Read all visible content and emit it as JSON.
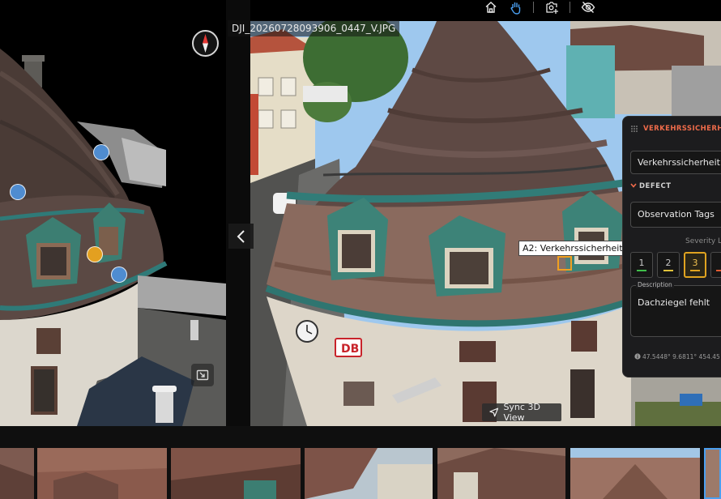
{
  "toolbar": {
    "icons": [
      "home-icon",
      "hand-pan-icon",
      "add-photo-icon",
      "hide-icon"
    ],
    "active_icon": "hand-pan-icon",
    "accent": "#4a9ff0"
  },
  "model_view": {
    "compass_icon": "compass-icon",
    "markers": [
      {
        "color": "blue"
      },
      {
        "color": "blue"
      },
      {
        "color": "orange"
      },
      {
        "color": "blue"
      }
    ],
    "expand_icon": "picture-in-picture-icon",
    "collapse_icon": "chevron-left-icon"
  },
  "photo": {
    "filename": "DJI_20260728093906_0447_V.JPG",
    "annotation_label": "A2: Verkehrssicherheit",
    "sync_label": "Sync 3D View",
    "sync_icon": "navigation-arrow-icon"
  },
  "panel": {
    "title": "VERKEHRSSICHERH...",
    "category_value": "Verkehrssicherheit",
    "section_title": "DEFECT",
    "tags_placeholder": "Observation Tags",
    "severity_label": "Severity Le",
    "severity_options": [
      {
        "label": "1",
        "color": "#3fbf4a"
      },
      {
        "label": "2",
        "color": "#e0c23a"
      },
      {
        "label": "3",
        "color": "#e0a320"
      },
      {
        "label": "",
        "color": "#e05a30"
      }
    ],
    "severity_selected": "3",
    "description_label": "Description",
    "description_text": "Dachziegel fehlt",
    "coordinates": "47.5448° 9.6811° 454.45"
  },
  "filmstrip": {
    "thumbnail_count": 7,
    "active_index": 6
  }
}
